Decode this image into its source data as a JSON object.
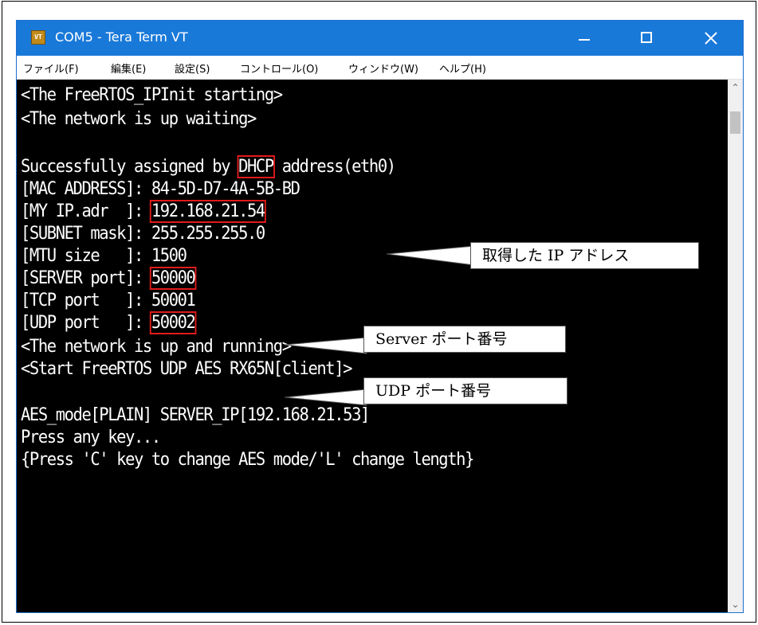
{
  "window": {
    "title": "COM5 - Tera Term VT",
    "icon_name": "tera-term-app-icon",
    "icon_text": "VT"
  },
  "menu": [
    "ファイル(F)",
    "編集(E)",
    "設定(S)",
    "コントロール(O)",
    "ウィンドウ(W)",
    "ヘルプ(H)"
  ],
  "terminal": {
    "line_01": "<The FreeRTOS_IPInit starting>",
    "line_02": "<The network is up waiting>",
    "line_03": "",
    "line_04_a": "Successfully assigned by ",
    "line_04_hl": "DHCP",
    "line_04_b": " address(eth0)",
    "line_05": "[MAC ADDRESS]: 84-5D-D7-4A-5B-BD",
    "line_06_a": "[MY IP.adr  ]: ",
    "line_06_hl": "192.168.21.54",
    "line_07": "[SUBNET mask]: 255.255.255.0",
    "line_08": "[MTU size   ]: 1500",
    "line_09_a": "[SERVER port]: ",
    "line_09_hl": "50000",
    "line_10": "[TCP port   ]: 50001",
    "line_11_a": "[UDP port   ]: ",
    "line_11_hl": "50002",
    "line_12": "<The network is up and running>",
    "line_13": "<Start FreeRTOS UDP AES RX65N[client]>",
    "line_14": "",
    "line_15": "AES_mode[PLAIN] SERVER_IP[192.168.21.53]",
    "line_16": "Press any key...",
    "line_17": "{Press 'C' key to change AES mode/'L' change length}"
  },
  "callouts": {
    "ip": "取得した IP アドレス",
    "server_port": "Server ポート番号",
    "udp_port": "UDP ポート番号"
  },
  "colors": {
    "titlebar": "#1979d9",
    "terminal_bg": "#000000",
    "terminal_fg": "#ffffff",
    "highlight": "#e01b1b"
  }
}
